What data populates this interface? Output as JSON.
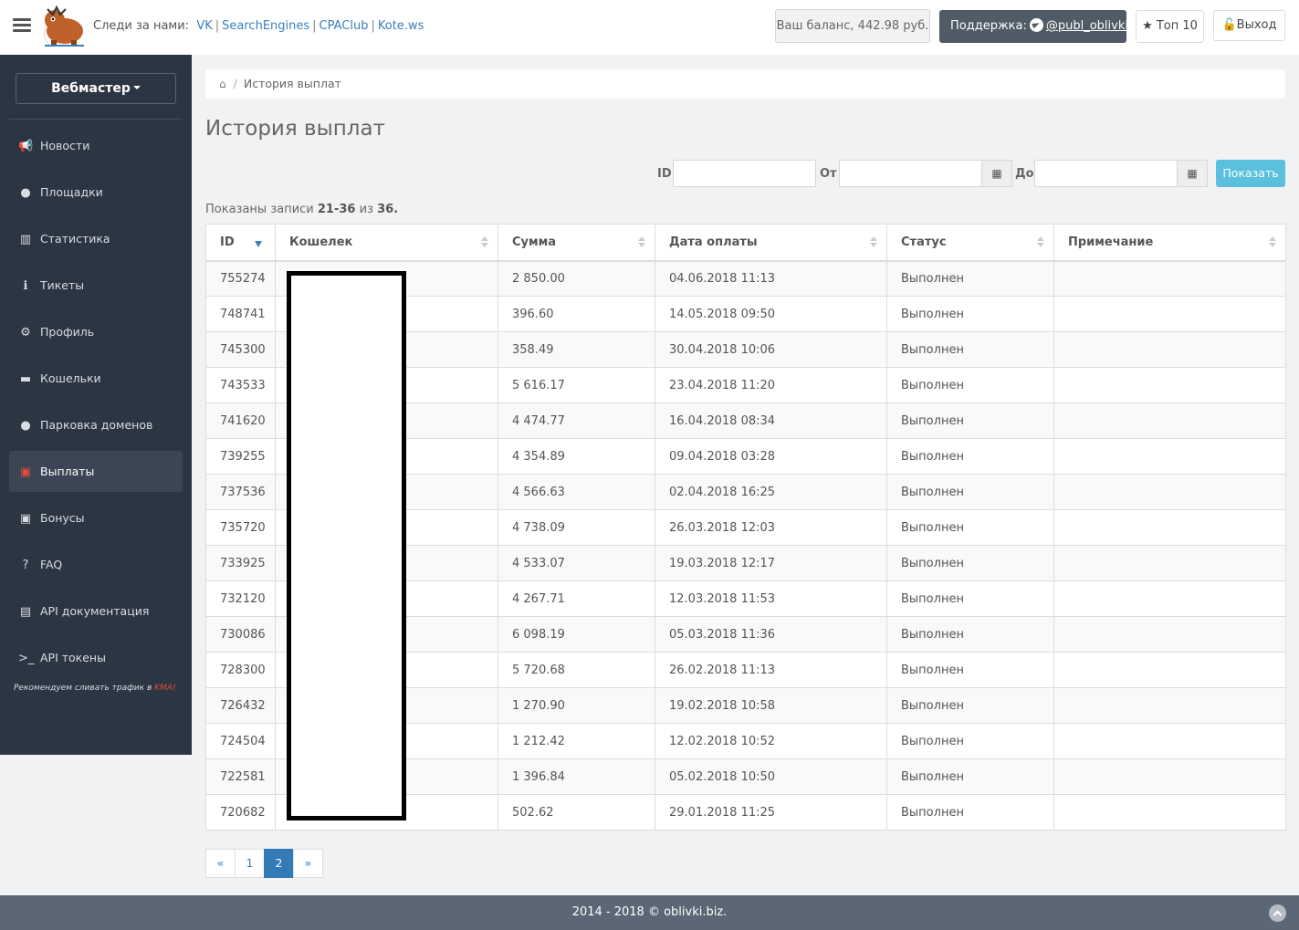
{
  "header": {
    "follow_label": "Следи за нами:",
    "social_links": [
      "VK",
      "SearchEngines",
      "CPAClub",
      "Kote.ws"
    ],
    "balance": "Ваш баланс, 442.98 руб.",
    "support_label": "Поддержка:",
    "support_handle": "@publ_oblivki",
    "top10_label": "Топ 10",
    "logout_label": "Выход"
  },
  "sidebar": {
    "role": "Вебмастер",
    "items": [
      {
        "label": "Новости",
        "icon": "bullhorn-icon"
      },
      {
        "label": "Площадки",
        "icon": "globe-icon"
      },
      {
        "label": "Статистика",
        "icon": "bar-chart-icon"
      },
      {
        "label": "Тикеты",
        "icon": "info-circle-icon"
      },
      {
        "label": "Профиль",
        "icon": "gears-icon"
      },
      {
        "label": "Кошельки",
        "icon": "credit-card-icon"
      },
      {
        "label": "Парковка доменов",
        "icon": "globe-icon"
      },
      {
        "label": "Выплаты",
        "icon": "money-icon"
      },
      {
        "label": "Бонусы",
        "icon": "money-icon"
      },
      {
        "label": "FAQ",
        "icon": "question-circle-icon"
      },
      {
        "label": "API документация",
        "icon": "book-icon"
      },
      {
        "label": "API токены",
        "icon": "terminal-icon"
      }
    ],
    "active_item": "Выплаты",
    "recommend_text": "Рекомендуем сливать трафик в",
    "recommend_link": "KMA!"
  },
  "breadcrumb": {
    "current": "История выплат"
  },
  "page_title": "История выплат",
  "filter": {
    "id_label": "ID",
    "from_label": "От",
    "to_label": "До",
    "show_button": "Показать"
  },
  "summary": {
    "prefix": "Показаны записи",
    "range": "21-36",
    "of": "из",
    "total": "36."
  },
  "table": {
    "columns": [
      "ID",
      "Кошелек",
      "Сумма",
      "Дата оплаты",
      "Статус",
      "Примечание"
    ],
    "rows": [
      {
        "id": "755274",
        "amount": "2 850.00",
        "date": "04.06.2018 11:13",
        "status": "Выполнен"
      },
      {
        "id": "748741",
        "amount": "396.60",
        "date": "14.05.2018 09:50",
        "status": "Выполнен"
      },
      {
        "id": "745300",
        "amount": "358.49",
        "date": "30.04.2018 10:06",
        "status": "Выполнен"
      },
      {
        "id": "743533",
        "amount": "5 616.17",
        "date": "23.04.2018 11:20",
        "status": "Выполнен"
      },
      {
        "id": "741620",
        "amount": "4 474.77",
        "date": "16.04.2018 08:34",
        "status": "Выполнен"
      },
      {
        "id": "739255",
        "amount": "4 354.89",
        "date": "09.04.2018 03:28",
        "status": "Выполнен"
      },
      {
        "id": "737536",
        "amount": "4 566.63",
        "date": "02.04.2018 16:25",
        "status": "Выполнен"
      },
      {
        "id": "735720",
        "amount": "4 738.09",
        "date": "26.03.2018 12:03",
        "status": "Выполнен"
      },
      {
        "id": "733925",
        "amount": "4 533.07",
        "date": "19.03.2018 12:17",
        "status": "Выполнен"
      },
      {
        "id": "732120",
        "amount": "4 267.71",
        "date": "12.03.2018 11:53",
        "status": "Выполнен"
      },
      {
        "id": "730086",
        "amount": "6 098.19",
        "date": "05.03.2018 11:36",
        "status": "Выполнен"
      },
      {
        "id": "728300",
        "amount": "5 720.68",
        "date": "26.02.2018 11:13",
        "status": "Выполнен"
      },
      {
        "id": "726432",
        "amount": "1 270.90",
        "date": "19.02.2018 10:58",
        "status": "Выполнен"
      },
      {
        "id": "724504",
        "amount": "1 212.42",
        "date": "12.02.2018 10:52",
        "status": "Выполнен"
      },
      {
        "id": "722581",
        "amount": "1 396.84",
        "date": "05.02.2018 10:50",
        "status": "Выполнен"
      },
      {
        "id": "720682",
        "amount": "502.62",
        "date": "29.01.2018 11:25",
        "status": "Выполнен"
      }
    ]
  },
  "pagination": {
    "prev": "«",
    "pages": [
      "1",
      "2"
    ],
    "active": "2",
    "next": "»"
  },
  "footer": {
    "text": "2014 - 2018 © oblivki.biz."
  },
  "colors": {
    "sidebar_bg": "#2c3542",
    "accent_red": "#e74c3c",
    "link_blue": "#3a7fbf",
    "show_button": "#5bc0de",
    "footer_bg": "#5b6774"
  }
}
